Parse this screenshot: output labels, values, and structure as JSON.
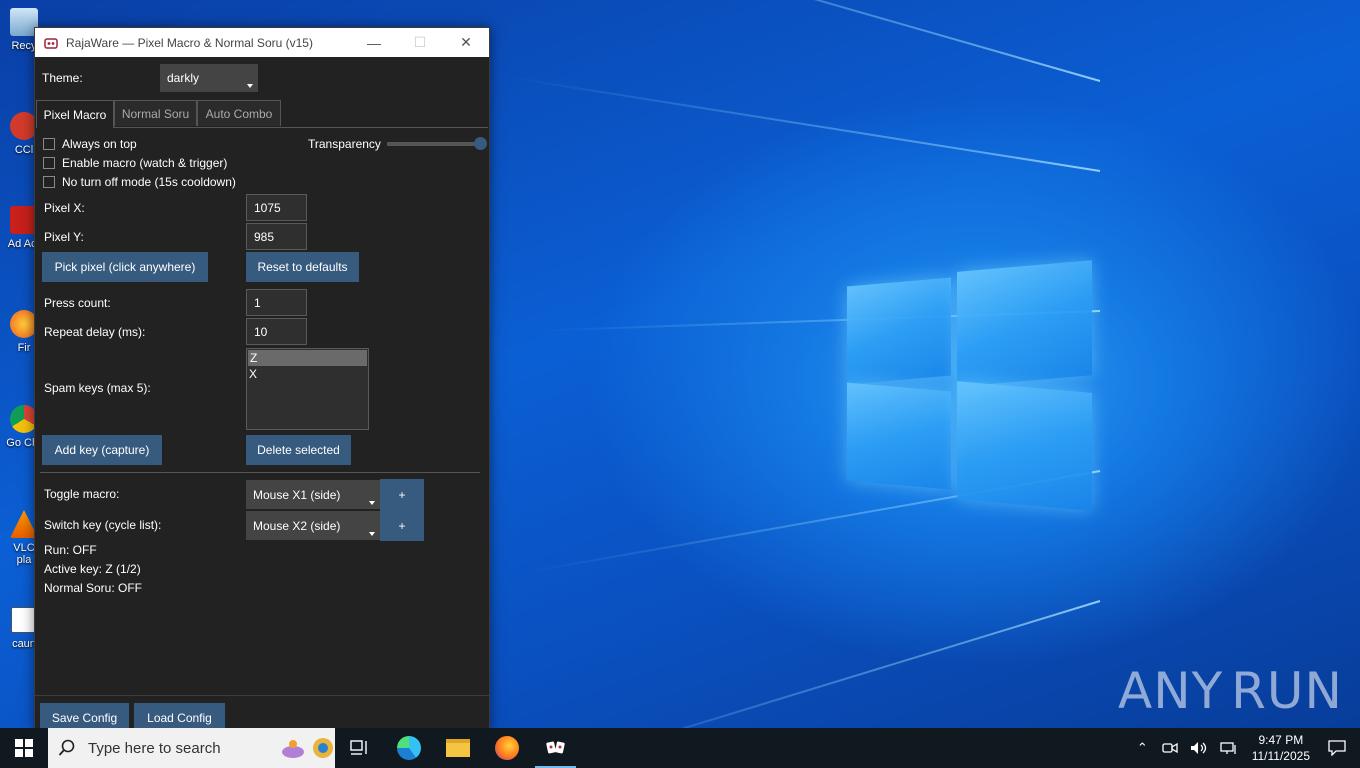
{
  "window": {
    "title": "RajaWare — Pixel Macro & Normal Soru (v15)",
    "theme_label": "Theme:",
    "theme_value": "darkly",
    "tabs": [
      {
        "label": "Pixel Macro",
        "active": true
      },
      {
        "label": "Normal Soru",
        "active": false
      },
      {
        "label": "Auto Combo",
        "active": false
      }
    ],
    "checkboxes": [
      {
        "label": "Always on top",
        "checked": false
      },
      {
        "label": "Enable macro (watch & trigger)",
        "checked": false
      },
      {
        "label": "No turn off mode (15s cooldown)",
        "checked": false
      }
    ],
    "transparency_label": "Transparency",
    "transparency_level": 1.0,
    "pixel_x_label": "Pixel X:",
    "pixel_x_value": "1075",
    "pixel_y_label": "Pixel Y:",
    "pixel_y_value": "985",
    "pick_pixel_button": "Pick pixel (click anywhere)",
    "reset_button": "Reset to defaults",
    "press_count_label": "Press count:",
    "press_count_value": "1",
    "repeat_delay_label": "Repeat delay (ms):",
    "repeat_delay_value": "10",
    "spam_keys_label": "Spam keys (max 5):",
    "spam_keys": [
      "Z",
      "X"
    ],
    "add_key_button": "Add key (capture)",
    "delete_button": "Delete selected",
    "toggle_macro_label": "Toggle macro:",
    "toggle_macro_value": "Mouse X1 (side)",
    "switch_key_label": "Switch key (cycle list):",
    "switch_key_value": "Mouse X2 (side)",
    "plus_label": "+",
    "status_run": "Run: OFF",
    "status_active_key": "Active key: Z (1/2)",
    "status_normal_soru": "Normal Soru: OFF",
    "save_button": "Save Config",
    "load_button": "Load Config"
  },
  "desktop_icons": [
    {
      "label": "Recy",
      "icon": "recycle-bin-icon"
    },
    {
      "label": "CCl",
      "icon": "ccleaner-icon"
    },
    {
      "label": "Ad Acr",
      "icon": "acrobat-icon"
    },
    {
      "label": "Fir",
      "icon": "firefox-icon"
    },
    {
      "label": "Go Chr",
      "icon": "chrome-icon"
    },
    {
      "label": "VLC pla",
      "icon": "vlc-icon"
    },
    {
      "label": "caun",
      "icon": "word-icon"
    }
  ],
  "taskbar": {
    "search_placeholder": "Type here to search",
    "time": "9:47 PM",
    "date": "11/11/2025"
  },
  "watermark": {
    "left": "ANY",
    "right": "RUN"
  },
  "colors": {
    "accent_button": "#375a7f",
    "window_bg": "#222222"
  }
}
